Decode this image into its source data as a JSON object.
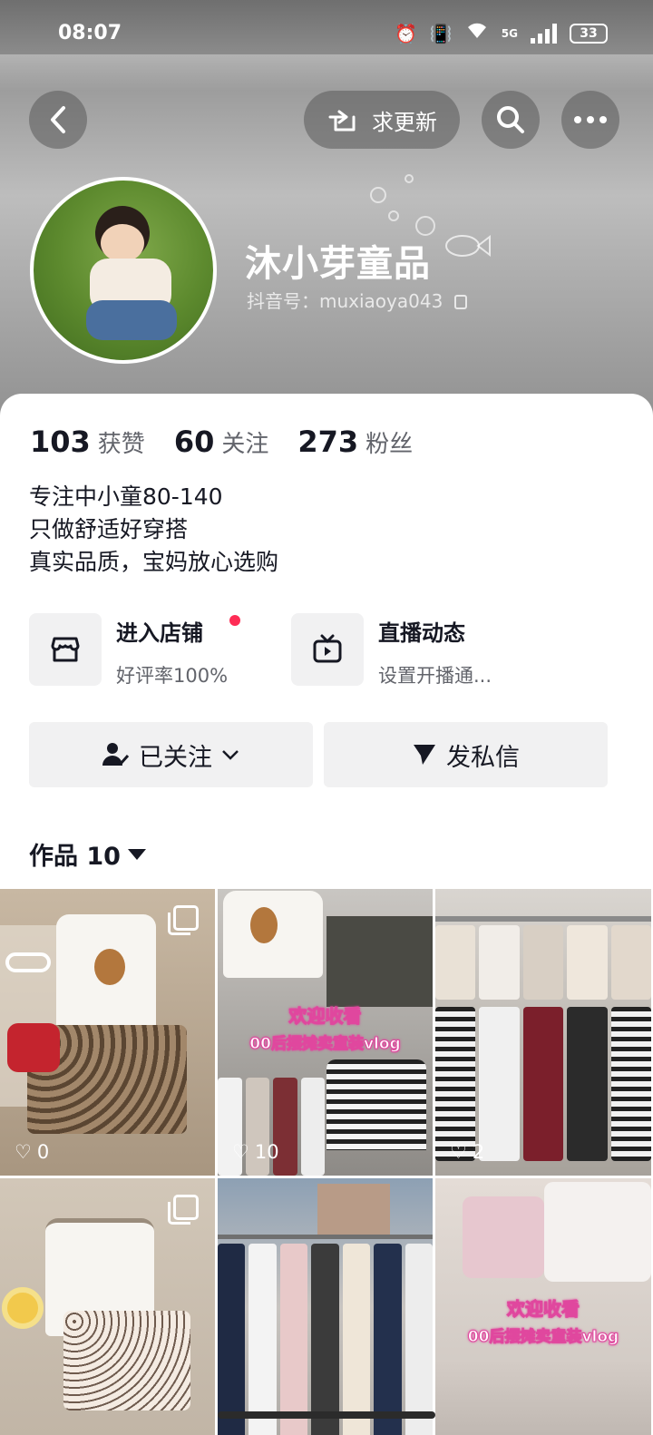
{
  "status_bar": {
    "time": "08:07",
    "battery": "33",
    "network": "5G"
  },
  "header": {
    "request_update_label": "求更新",
    "name": "沐小芽童品",
    "douyin_id": "抖音号：muxiaoya043"
  },
  "stats": [
    {
      "num": "103",
      "label": "获赞"
    },
    {
      "num": "60",
      "label": "关注"
    },
    {
      "num": "273",
      "label": "粉丝"
    }
  ],
  "bio": [
    "专注中小童80-140",
    "只做舒适好穿搭",
    "真实品质，宝妈放心选购"
  ],
  "cards": {
    "shop": {
      "title": "进入店铺",
      "subtitle": "好评率100%"
    },
    "live": {
      "title": "直播动态",
      "subtitle": "设置开播通..."
    }
  },
  "actions": {
    "follow": "已关注",
    "message": "发私信"
  },
  "works": {
    "label": "作品 10"
  },
  "tiles": [
    {
      "likes": "0",
      "overlay": ""
    },
    {
      "likes": "10",
      "overlay_line1": "欢迎收看",
      "overlay_line2": "00后摆摊卖童装vlog"
    },
    {
      "likes": "2",
      "overlay": ""
    },
    {
      "likes": "",
      "overlay": ""
    },
    {
      "likes": "",
      "overlay": ""
    },
    {
      "likes": "",
      "overlay_line1": "欢迎收看",
      "overlay_line2": "00后摆摊卖童装vlog"
    }
  ],
  "colors": {
    "accent": "#fe2c55",
    "text": "#161823",
    "subtle": "#62646b",
    "button_bg": "#f1f1f2"
  }
}
